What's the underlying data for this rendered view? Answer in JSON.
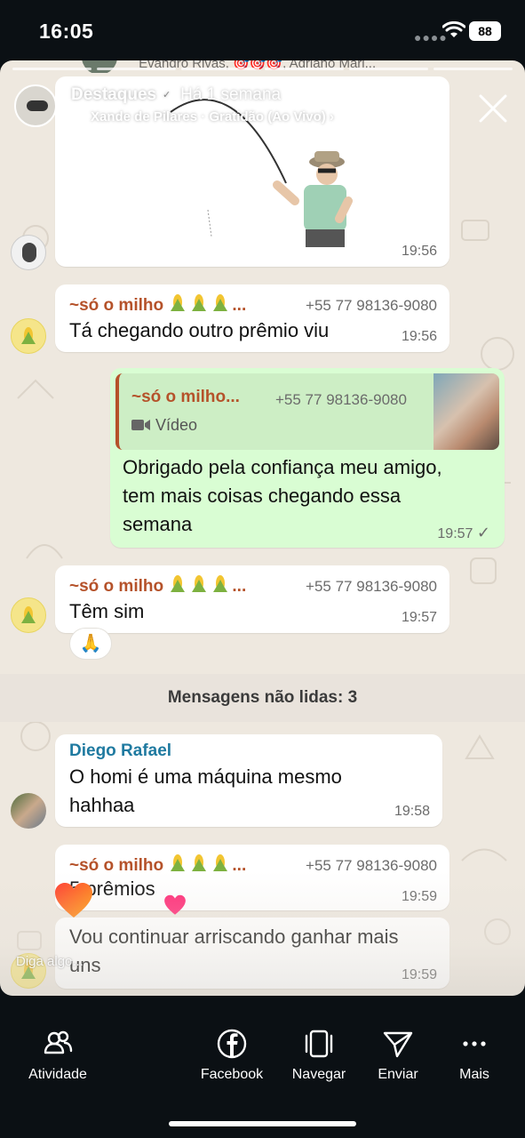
{
  "status_bar": {
    "time": "16:05",
    "battery": "88"
  },
  "story": {
    "partial_top_text": "Evandro Rivas, 🎯🎯🎯, Adriano Mari...",
    "title": "Destaques",
    "age": "Há 1 semana",
    "music": "Xande de Pilares · Gratidão (Ao Vivo) ›"
  },
  "messages": [
    {
      "id": "sticker",
      "time": "19:56"
    },
    {
      "id": "m1",
      "sender": "~só o milho",
      "phone": "+55 77 98136-9080",
      "text": "Tá chegando outro prêmio viu",
      "time": "19:56"
    },
    {
      "id": "m2",
      "quoted_sender": "~só o milho...",
      "quoted_phone": "+55 77 98136-9080",
      "quoted_type": "Vídeo",
      "text_line1": "Obrigado pela confiança meu amigo,",
      "text_line2": "tem mais coisas chegando essa",
      "text_line3": "semana",
      "time": "19:57",
      "status": "✓"
    },
    {
      "id": "m3",
      "sender": "~só o milho",
      "phone": "+55 77 98136-9080",
      "text": "Têm sim",
      "time": "19:57",
      "reaction": "🙏"
    },
    {
      "id": "m4",
      "sender": "Diego Rafael",
      "text_line1": "O homi é uma máquina mesmo",
      "text_line2": "hahhaa",
      "time": "19:58"
    },
    {
      "id": "m5",
      "sender": "~só o milho",
      "phone": "+55 77 98136-9080",
      "text": "5 prêmios",
      "time": "19:59"
    },
    {
      "id": "m6",
      "text_line1": "Vou continuar arriscando ganhar mais",
      "text_line2": "uns",
      "time": "19:59"
    }
  ],
  "unread_banner": "Mensagens não lidas: 3",
  "reply_placeholder": "Diga algo...",
  "bottom_nav": [
    {
      "label": "Atividade",
      "icon": "people-icon"
    },
    {
      "label": "Facebook",
      "icon": "facebook-icon"
    },
    {
      "label": "Navegar",
      "icon": "browse-icon"
    },
    {
      "label": "Enviar",
      "icon": "send-icon"
    },
    {
      "label": "Mais",
      "icon": "more-icon"
    }
  ]
}
